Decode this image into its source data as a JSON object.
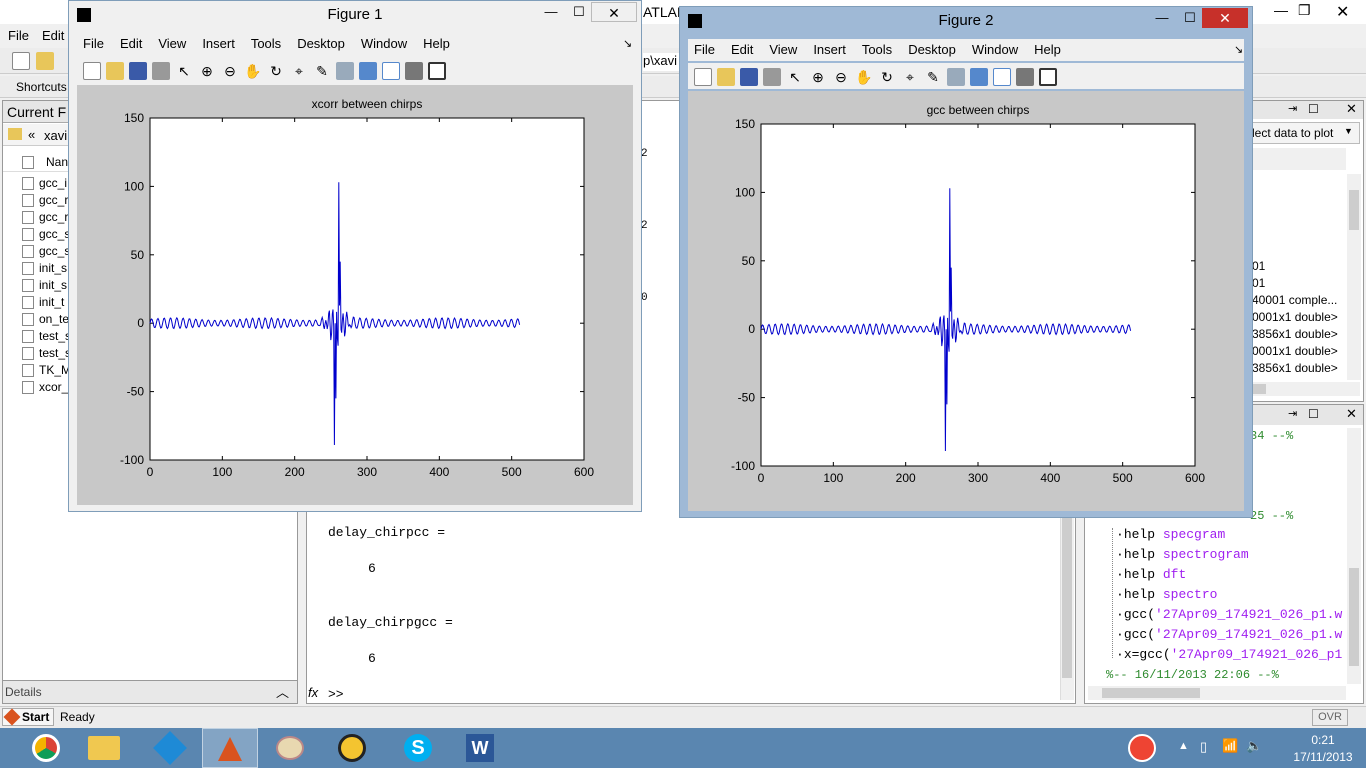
{
  "main_window": {
    "title_fragment": "ATLAB",
    "menu_file": "File",
    "menu_edit": "Edit",
    "shortcuts": "Shortcuts",
    "path_fragment": "p\\xavi"
  },
  "current_folder": {
    "title": "Current F",
    "path": "xavi",
    "name_header": "Nan",
    "files": [
      "gcc_i",
      "gcc_r",
      "gcc_r",
      "gcc_s",
      "gcc_s",
      "init_s",
      "init_s",
      "init_t",
      "on_te",
      "test_s",
      "test_s",
      "TK_M",
      "xcor_"
    ],
    "details_label": "Details"
  },
  "command_window": {
    "lines": [
      "delay_chirpcc =",
      "6",
      "delay_chirpgcc =",
      "6"
    ],
    "prompt": ">>",
    "fx_label": "fx",
    "partial_numbers": [
      "2",
      "2",
      "0"
    ]
  },
  "workspace": {
    "plot_selector": "lect data to plot",
    "rows": [
      "01",
      "01",
      "40001 comple...",
      "0001x1 double>",
      "3856x1 double>",
      "0001x1 double>",
      "3856x1 double>"
    ]
  },
  "history": {
    "header_1": "34 --%",
    "header_2": "25 --%",
    "cmds": [
      {
        "kw": "help",
        "arg": "specgram"
      },
      {
        "kw": "help",
        "arg": "spectrogram"
      },
      {
        "kw": "help",
        "arg": "dft"
      },
      {
        "kw": "help",
        "arg": "spectro"
      },
      {
        "kw": "gcc(",
        "arg": "'27Apr09_174921_026_p1.w"
      },
      {
        "kw": "gcc(",
        "arg": "'27Apr09_174921_026_p1.w"
      },
      {
        "kw": "x=gcc(",
        "arg": "'27Apr09_174921_026_p1"
      }
    ],
    "footer": "%-- 16/11/2013 22:06 --%"
  },
  "status_bar": {
    "start": "Start",
    "ready": "Ready",
    "ovr": "OVR"
  },
  "figure_menu": [
    "File",
    "Edit",
    "View",
    "Insert",
    "Tools",
    "Desktop",
    "Window",
    "Help"
  ],
  "figure1": {
    "title": "Figure 1",
    "plot_title": "xcorr between chirps"
  },
  "figure2": {
    "title": "Figure 2",
    "plot_title": "gcc between chirps"
  },
  "chart_data": [
    {
      "type": "line",
      "title": "xcorr between chirps",
      "xlim": [
        0,
        600
      ],
      "ylim": [
        -100,
        150
      ],
      "xticks": [
        0,
        100,
        200,
        300,
        400,
        500,
        600
      ],
      "yticks": [
        -100,
        -50,
        0,
        50,
        100,
        150
      ],
      "series": [
        {
          "color": "#0000cc",
          "x_range": [
            0,
            511
          ],
          "peak_x": 261,
          "peak_y": 103,
          "min_x": 255,
          "min_y": -89
        }
      ]
    },
    {
      "type": "line",
      "title": "gcc between chirps",
      "xlim": [
        0,
        600
      ],
      "ylim": [
        -100,
        150
      ],
      "xticks": [
        0,
        100,
        200,
        300,
        400,
        500,
        600
      ],
      "yticks": [
        -100,
        -50,
        0,
        50,
        100,
        150
      ],
      "series": [
        {
          "color": "#0000cc",
          "x_range": [
            0,
            511
          ],
          "peak_x": 261,
          "peak_y": 103,
          "min_x": 255,
          "min_y": -89
        }
      ]
    }
  ],
  "clock": {
    "time": "0:21",
    "date": "17/11/2013"
  },
  "colors": {
    "taskbar": "#5a86b0",
    "figure_frame": "#9fb9d6",
    "plot_line": "#0000cc",
    "close": "#c7302a"
  }
}
